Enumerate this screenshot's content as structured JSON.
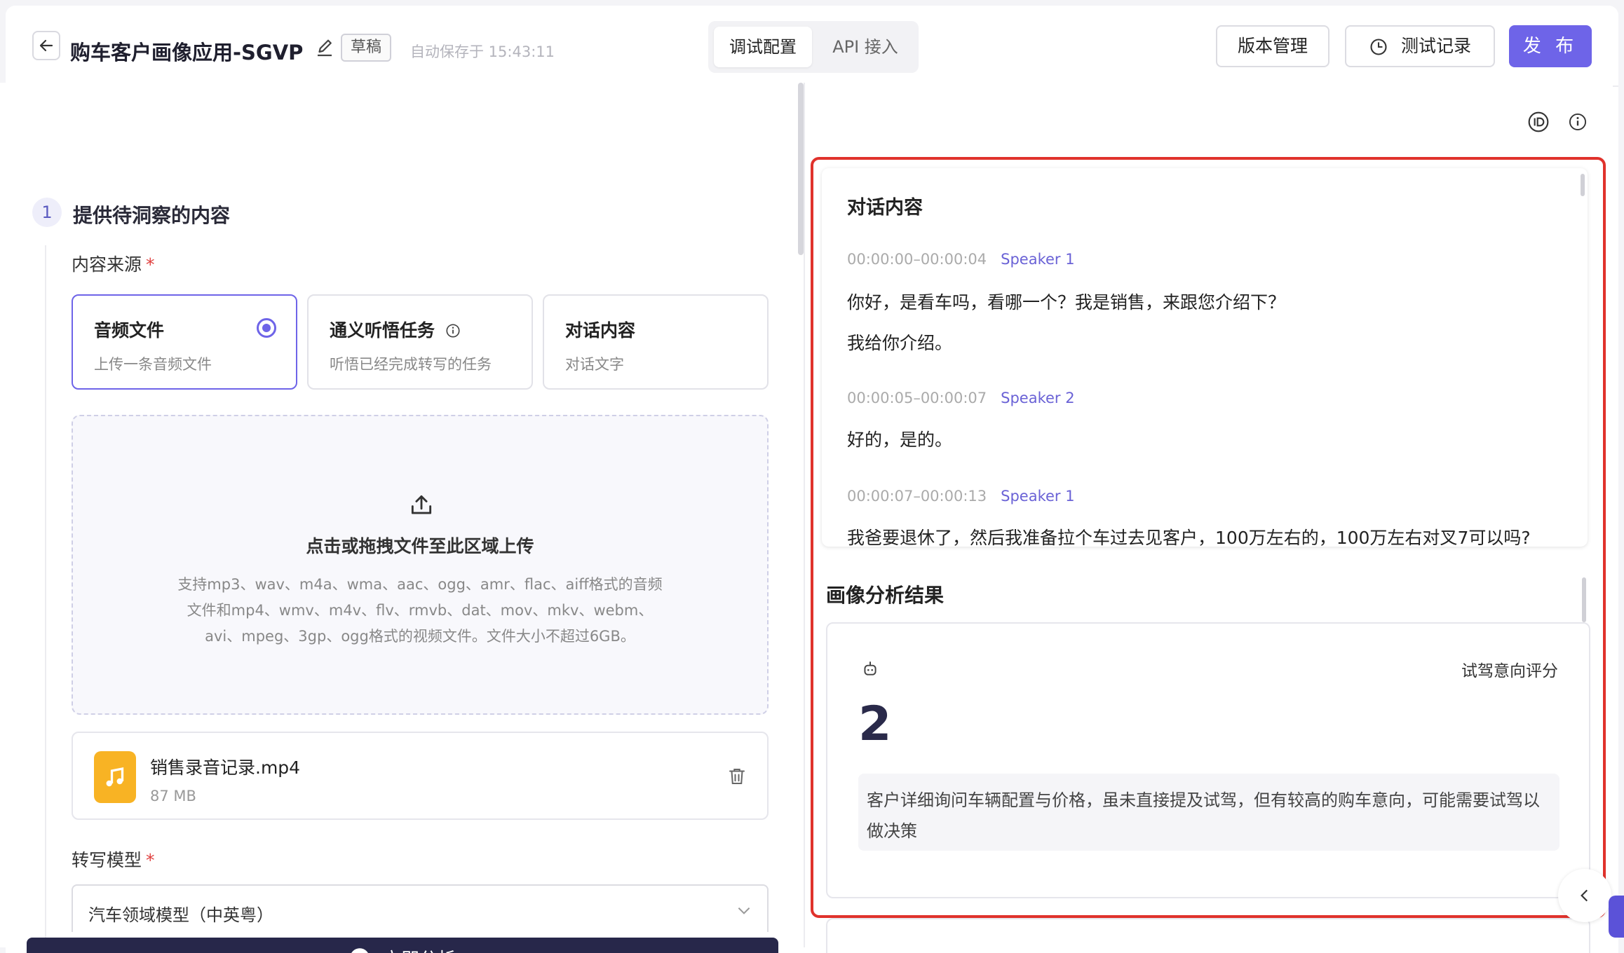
{
  "header": {
    "title": "购车客户画像应用-SGVP",
    "draft_badge": "草稿",
    "autosave": "自动保存于 15:43:11",
    "tabs": [
      {
        "label": "调试配置"
      },
      {
        "label": "API 接入"
      }
    ],
    "version_button": "版本管理",
    "test_record_button": "测试记录",
    "publish_button": "发 布"
  },
  "left": {
    "step_number": "1",
    "step_title": "提供待洞察的内容",
    "source_label": "内容来源",
    "sources": [
      {
        "title": "音频文件",
        "subtitle": "上传一条音频文件"
      },
      {
        "title": "通义听悟任务",
        "subtitle": "听悟已经完成转写的任务"
      },
      {
        "title": "对话内容",
        "subtitle": "对话文字"
      }
    ],
    "upload": {
      "title": "点击或拖拽文件至此区域上传",
      "description": "支持mp3、wav、m4a、wma、aac、ogg、amr、flac、aiff格式的音频文件和mp4、wmv、m4v、flv、rmvb、dat、mov、mkv、webm、avi、mpeg、3gp、ogg格式的视频文件。文件大小不超过6GB。"
    },
    "file": {
      "name": "销售录音记录.mp4",
      "size": "87 MB"
    },
    "model_label": "转写模型",
    "model_value": "汽车领域模型（中英粤）",
    "analyze_button": "立即分析"
  },
  "right": {
    "dialog": {
      "title": "对话内容",
      "utterances": [
        {
          "time": "00:00:00–00:00:04",
          "speaker": "Speaker 1",
          "lines": [
            "你好，是看车吗，看哪一个？我是销售，来跟您介绍下？",
            "我给你介绍。"
          ]
        },
        {
          "time": "00:00:05–00:00:07",
          "speaker": "Speaker 2",
          "lines": [
            "好的，是的。"
          ]
        },
        {
          "time": "00:00:07–00:00:13",
          "speaker": "Speaker 1",
          "lines": [
            "我爸要退休了，然后我准备拉个车过去见客户，100万左右的，100万左右对叉7可以吗?"
          ]
        }
      ]
    },
    "result": {
      "title": "画像分析结果",
      "score_label": "试驾意向评分",
      "score_value": "2",
      "score_desc": "客户详细询问车辆配置与价格，虽未直接提及试驾，但有较高的购车意向，可能需要试驾以做决策"
    }
  },
  "colors": {
    "accent": "#6e64e8",
    "dark_button": "#27274a",
    "highlight": "#e0322c",
    "file_icon": "#f8b324"
  }
}
